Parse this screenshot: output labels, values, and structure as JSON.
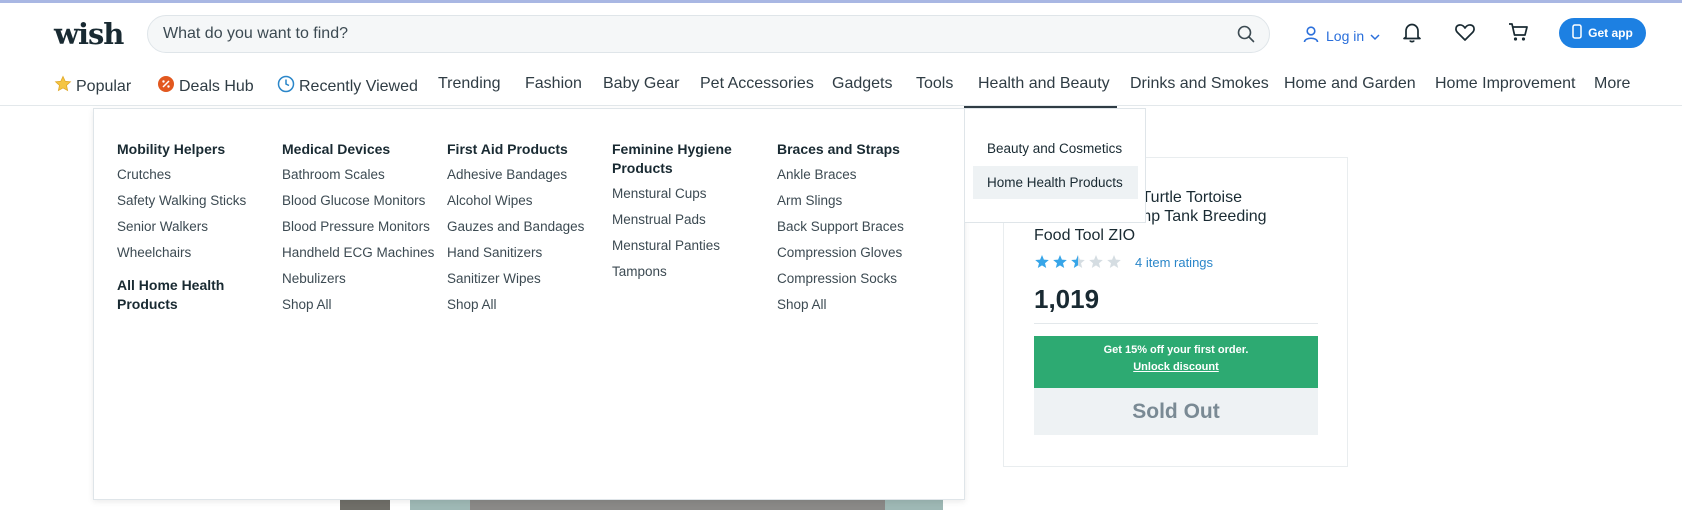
{
  "header": {
    "logo": "wish",
    "search_placeholder": "What do you want to find?",
    "login_label": "Log in",
    "get_app_label": "Get app"
  },
  "nav": {
    "items": [
      {
        "label": "Popular",
        "icon": "star-icon"
      },
      {
        "label": "Deals Hub",
        "icon": "deals-icon"
      },
      {
        "label": "Recently Viewed",
        "icon": "clock-icon"
      },
      {
        "label": "Trending"
      },
      {
        "label": "Fashion"
      },
      {
        "label": "Baby Gear"
      },
      {
        "label": "Pet Accessories"
      },
      {
        "label": "Gadgets"
      },
      {
        "label": "Tools"
      },
      {
        "label": "Health and Beauty"
      },
      {
        "label": "Drinks and Smokes"
      },
      {
        "label": "Home and Garden"
      },
      {
        "label": "Home Improvement"
      },
      {
        "label": "More"
      }
    ]
  },
  "mega_menu": {
    "columns": [
      {
        "heading": "Mobility Helpers",
        "links": [
          "Crutches",
          "Safety Walking Sticks",
          "Senior Walkers",
          "Wheelchairs"
        ],
        "extra_heading": "All Home Health Products"
      },
      {
        "heading": "Medical Devices",
        "links": [
          "Bathroom Scales",
          "Blood Glucose Monitors",
          "Blood Pressure Monitors",
          "Handheld ECG Machines",
          "Nebulizers",
          "Shop All"
        ]
      },
      {
        "heading": "First Aid Products",
        "links": [
          "Adhesive Bandages",
          "Alcohol Wipes",
          "Gauzes and Bandages",
          "Hand Sanitizers",
          "Sanitizer Wipes",
          "Shop All"
        ]
      },
      {
        "heading": "Feminine Hygiene Products",
        "links": [
          "Menstural Cups",
          "Menstrual Pads",
          "Menstural Panties",
          "Tampons"
        ]
      },
      {
        "heading": "Braces and Straps",
        "links": [
          "Ankle Braces",
          "Arm Slings",
          "Back Support Braces",
          "Compression Gloves",
          "Compression Socks",
          "Shop All"
        ]
      }
    ],
    "side_items": [
      "Beauty and Cosmetics",
      "Home Health Products"
    ],
    "active_side_item": "Home Health Products"
  },
  "product_card": {
    "title_visible": "m Box Turtle Tortoise\n           amp Tank Breeding\nFood Tool ZIO",
    "rating": 2.5,
    "rating_max": 5,
    "ratings_text": "4 item ratings",
    "price": "1,019",
    "promo_line": "Get 15% off your first order.",
    "promo_link": "Unlock discount",
    "sold_out": "Sold Out"
  },
  "colors": {
    "accent_blue": "#1d80e2",
    "promo_green": "#2daa72",
    "star_blue": "#37a5e8"
  }
}
